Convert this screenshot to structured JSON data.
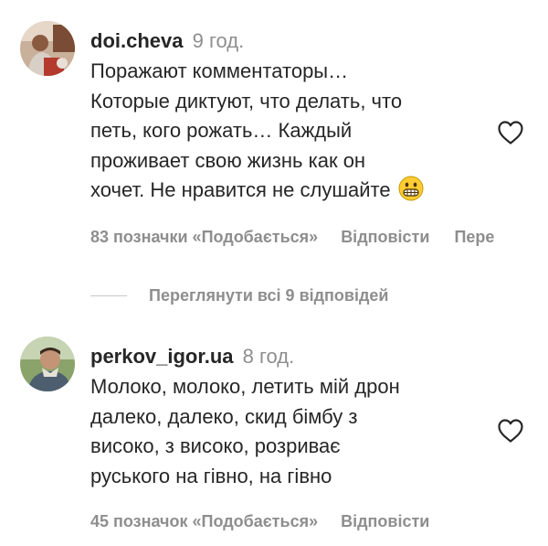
{
  "comments": [
    {
      "username": "doi.cheva",
      "time": "9 год.",
      "text": "Поражают комментаторы…\nКоторые диктуют, что делать, что\nпеть, кого рожать… Каждый\nпроживает свою жизнь как он\nхочет. Не нравится не слушайте",
      "emoji": "grimacing-face-emoji",
      "likes": "83 позначки «Подобається»",
      "reply": "Відповісти",
      "extra": "Пере"
    },
    {
      "username": "perkov_igor.ua",
      "time": "8 год.",
      "text": "Молоко, молоко, летить мій дрон\nдалеко, далеко, скид бімбу з\nвисоко, з високо, розриває\nруського на гівно, на гівно",
      "likes": "45 позначок «Подобається»",
      "reply": "Відповісти"
    }
  ],
  "view_replies": "Переглянути всі 9 відповідей",
  "colors": {
    "text": "#262626",
    "secondary": "#8e8e8e",
    "divider": "#c7c7c7"
  },
  "icons": {
    "like": "heart-outline-icon",
    "avatar": "user-photo"
  }
}
